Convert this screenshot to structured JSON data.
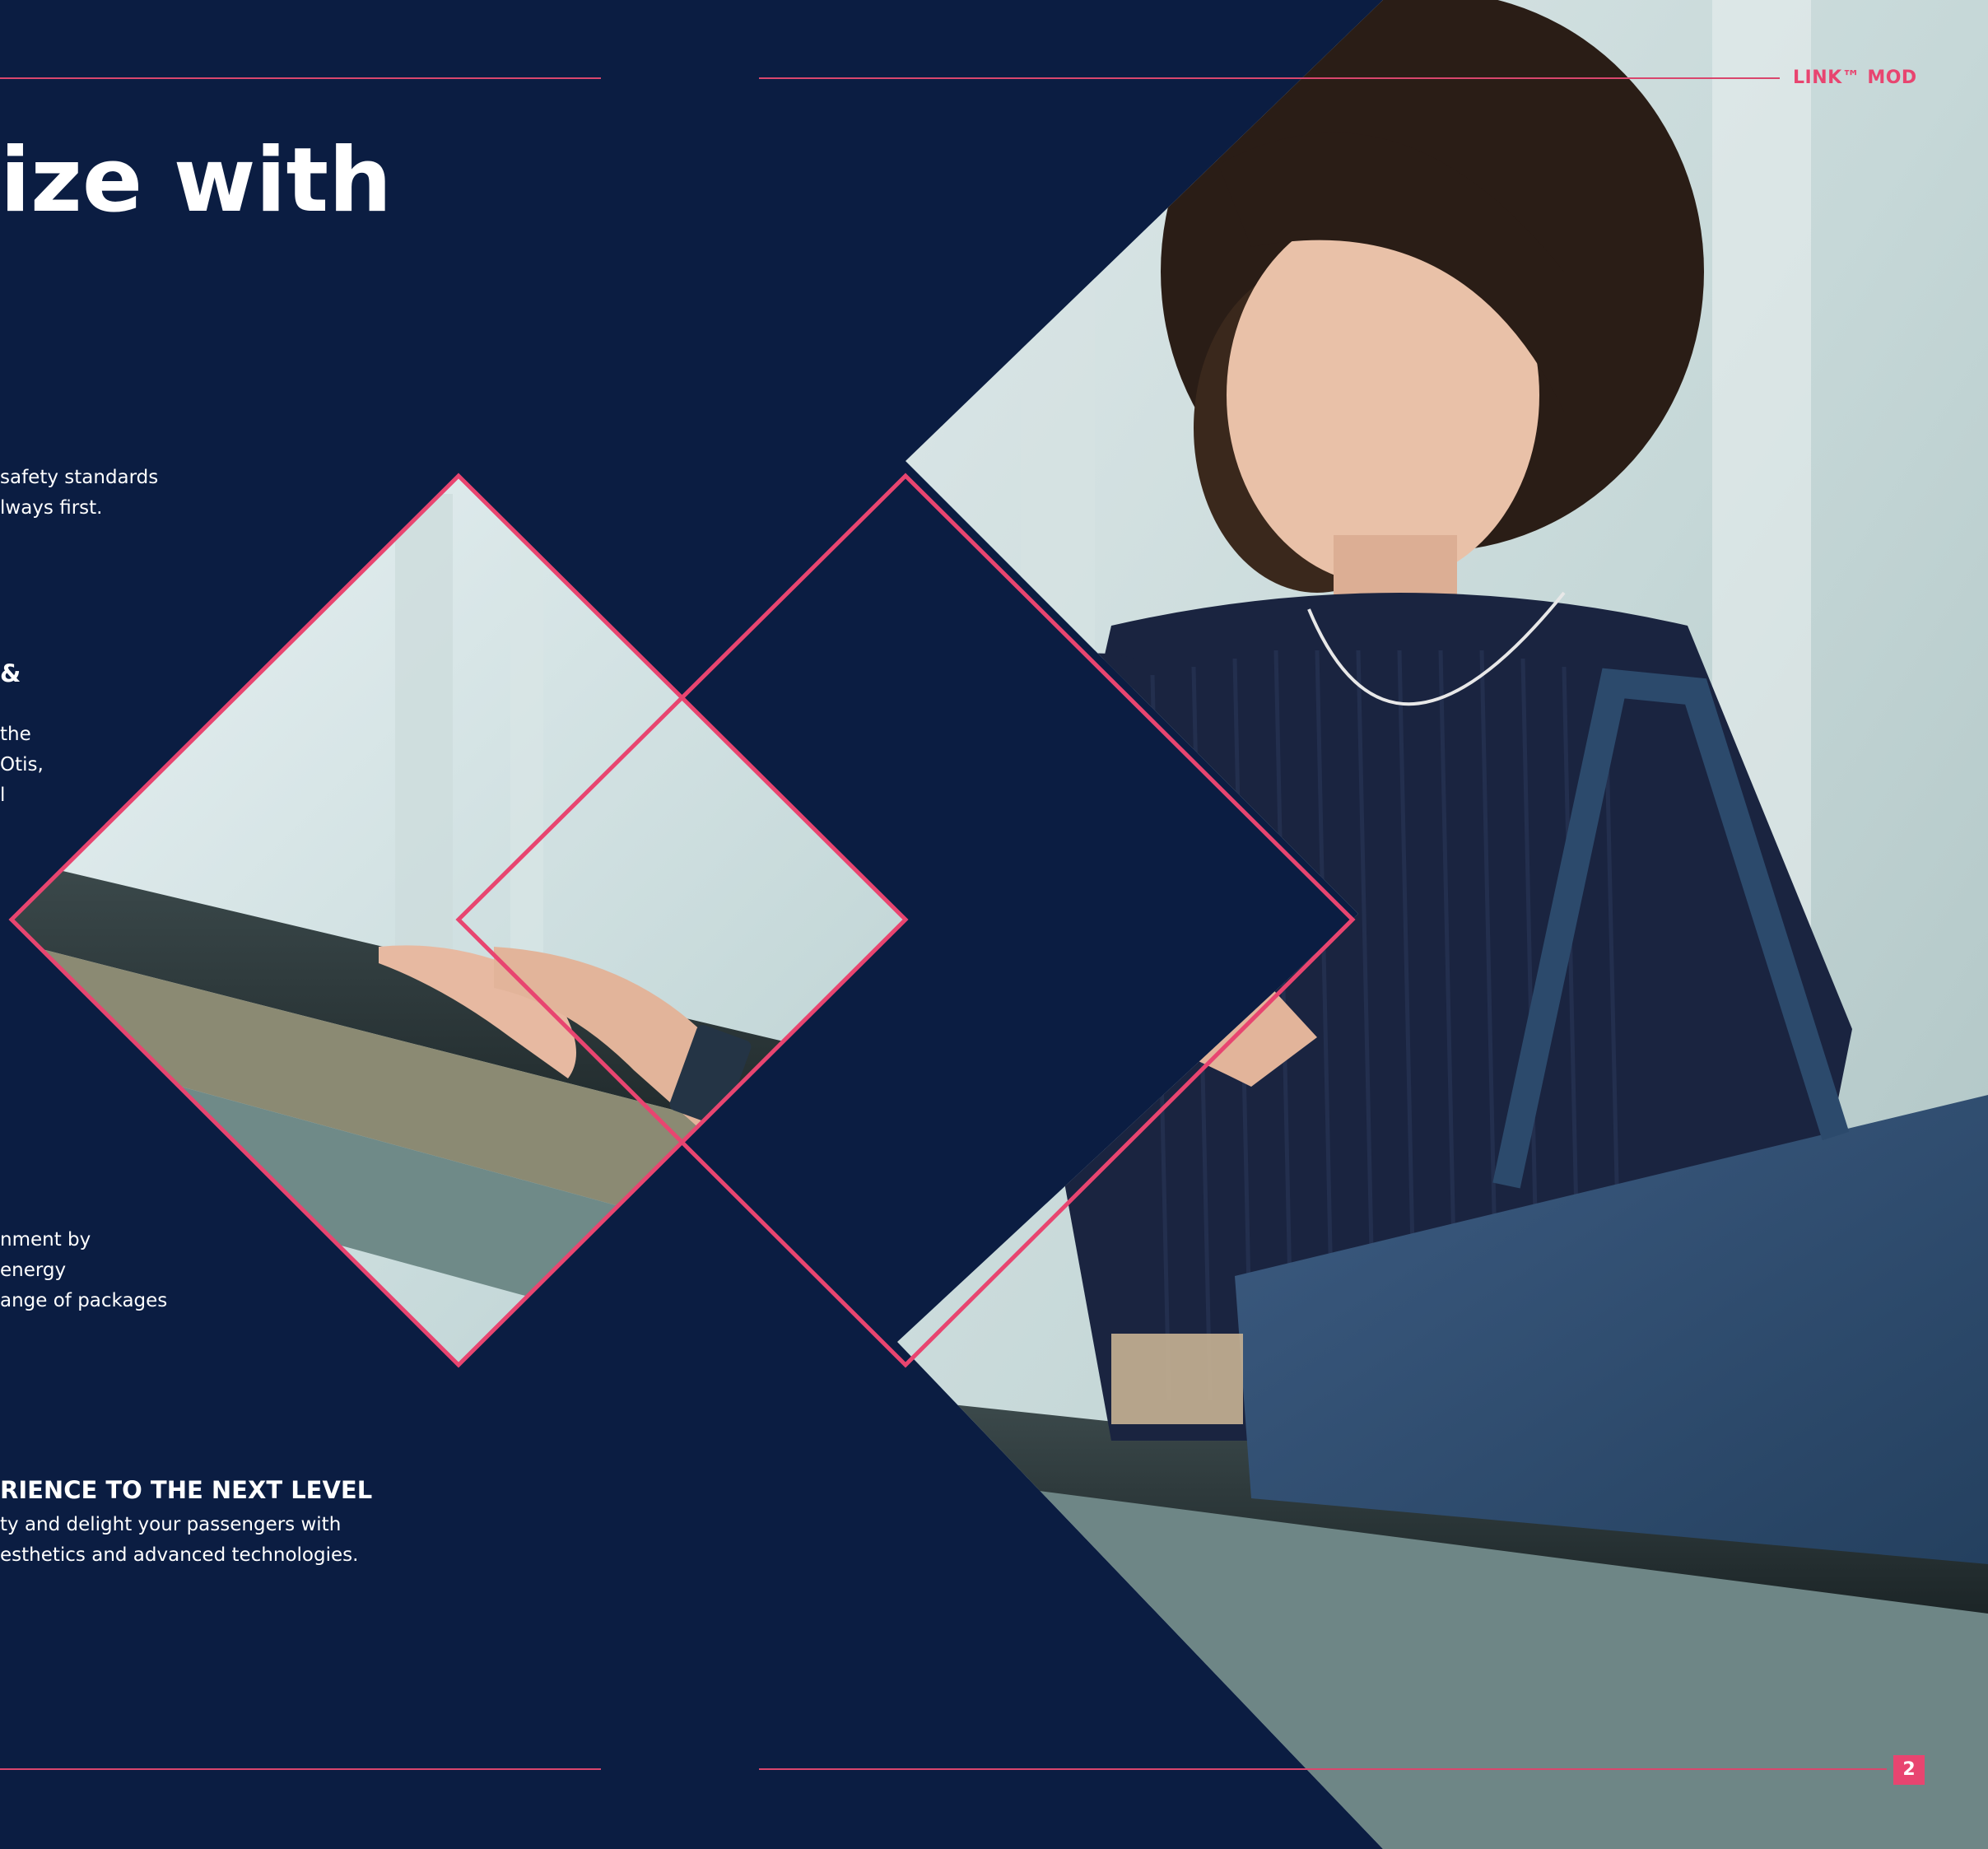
{
  "header": {
    "brand": "LINK™ MOD"
  },
  "headline": "ize with",
  "sections": {
    "safety": {
      "line1": "safety standards",
      "line2": "lways first."
    },
    "connect": {
      "heading": "&",
      "line1": "the",
      "line2": "Otis,",
      "line3": "l"
    },
    "energy": {
      "line1": "nment by",
      "line2": "energy",
      "line3": "ange of packages"
    },
    "experience": {
      "heading": "RIENCE TO THE NEXT LEVEL",
      "line1": "ty and delight your passengers with",
      "line2": "esthetics and advanced technologies."
    }
  },
  "footer": {
    "page_number": "2"
  },
  "colors": {
    "background": "#0b1d42",
    "accent": "#e84570"
  },
  "image": {
    "subject": "woman with phone on escalator"
  }
}
